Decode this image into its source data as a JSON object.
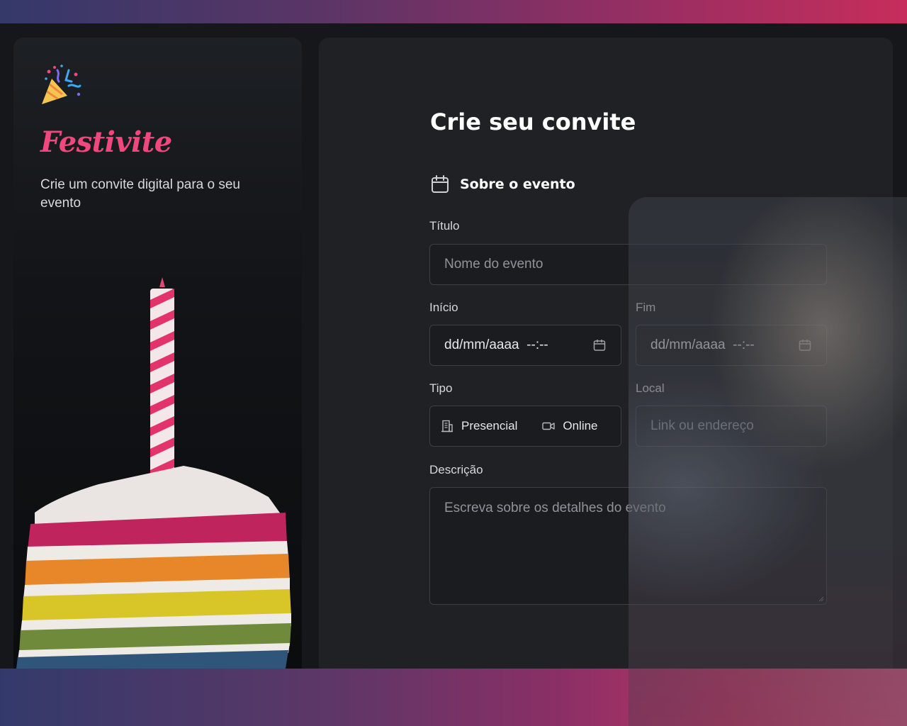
{
  "brand": {
    "name": "Festivite",
    "tagline": "Crie um convite digital para o seu evento",
    "logo_icon": "party-popper-icon",
    "image": "rainbow-cake-slice-with-candle"
  },
  "form": {
    "title": "Crie seu convite",
    "section": {
      "label": "Sobre o evento",
      "icon": "calendar-icon"
    },
    "titulo": {
      "label": "Título",
      "placeholder": "Nome do evento"
    },
    "inicio": {
      "label": "Início",
      "value": "dd/mm/aaaa  --:--",
      "icon": "calendar-icon"
    },
    "fim": {
      "label": "Fim",
      "value": "dd/mm/aaaa  --:--",
      "icon": "calendar-icon"
    },
    "tipo": {
      "label": "Tipo",
      "options": [
        {
          "label": "Presencial",
          "icon": "building-icon"
        },
        {
          "label": "Online",
          "icon": "video-camera-icon"
        }
      ]
    },
    "local": {
      "label": "Local",
      "placeholder": "Link ou endereço"
    },
    "descricao": {
      "label": "Descrição",
      "placeholder": "Escreva sobre os detalhes do evento"
    }
  },
  "colors": {
    "accent": "#f0487e",
    "background": "#15171a",
    "panel": "#1f2124",
    "gradient_start": "#34396a",
    "gradient_end": "#c62d5b"
  }
}
